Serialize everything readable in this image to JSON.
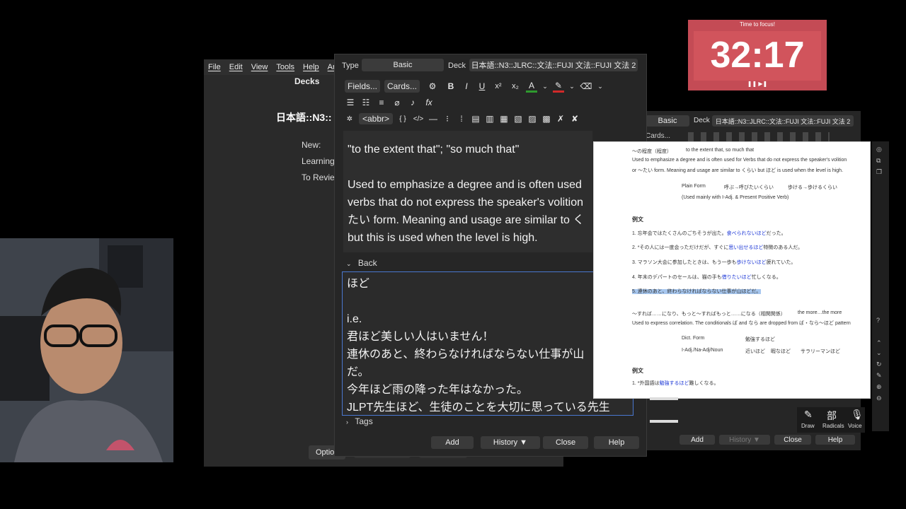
{
  "main_window": {
    "menu": [
      "File",
      "Edit",
      "View",
      "Tools",
      "Help",
      "Anki"
    ],
    "title": "Decks",
    "deck_name": "日本語::N3::",
    "stats": [
      "New:",
      "Learning",
      "To Revie"
    ],
    "options_label": "Option"
  },
  "add_window": {
    "type_label": "Type",
    "type_value": "Basic",
    "deck_label": "Deck",
    "deck_value": "日本語::N3::JLRC::文法::FUJI 文法::FUJI 文法 2",
    "fields_btn": "Fields...",
    "cards_btn": "Cards...",
    "format": {
      "bold": "B",
      "italic": "I",
      "underline": "U",
      "superscript": "x²",
      "subscript": "x₂",
      "font_color": "A",
      "abbr": "<abbr>",
      "braces": "{ }",
      "code": "</>",
      "math": "fx"
    },
    "front_lines": [
      "\"to the extent that\"; \"so much that\"",
      "",
      "Used to emphasize a degree and is often used",
      "verbs that do not express the speaker's volition",
      "たい form. Meaning and usage are similar to く",
      "but this is used when the level is high."
    ],
    "back_label": "Back",
    "back_lines": [
      "ほど",
      "",
      "i.e.",
      "君ほど美しい人はいません！",
      "連休のあと、終わらなければならない仕事が山",
      "だ。",
      "今年ほど雨の降った年はなかった。",
      "JLPT先生ほど、生徒のことを大切に思っている先生"
    ],
    "tags_label": "Tags",
    "buttons": {
      "add": "Add",
      "history": "History ▼",
      "close": "Close",
      "help": "Help"
    }
  },
  "add_window_2": {
    "type_value": "Basic",
    "deck_label": "Deck",
    "deck_value": "日本語::N3::JLRC::文法::FUJI 文法::FUJI 文法 2",
    "cards_btn": "Cards...",
    "buttons": {
      "add": "Add",
      "history": "History ▼",
      "close": "Close",
      "help": "Help"
    }
  },
  "preview": {
    "heading1": "〜の程度（程度）",
    "heading1_en": "to the extent that, so much that",
    "desc1": "Used to emphasize a degree and is often used for Verbs that do not express the speaker's volition",
    "desc2": "or 〜たい form. Meaning and usage are similar to くらい but ほど is used when the level is high.",
    "plain_form": "Plain Form",
    "pf1": "呼ぶ→呼びたいくらい",
    "pf2": "歩ける→歩けるくらい",
    "used_mainly": "(Used mainly with I-Adj. & Present Positive Verb)",
    "examples_title": "例文",
    "ex1": "1. 忘年会ではたくさんのごちそうが出た。",
    "ex1b": "食べられないほど",
    "ex1c": "だった。",
    "ex2": "2. *その人には一度会っただけだが、すぐに",
    "ex2b": "思い出せるほど",
    "ex2c": "特徴のある人だ。",
    "ex3": "3. マラソン大会に参加したときは、もう一歩も",
    "ex3b": "歩けないほど",
    "ex3c": "疲れていた。",
    "ex4": "4. 年末のデパートのセールは、猫の手も",
    "ex4b": "借りたいほど",
    "ex4c": "忙しくなる。",
    "ex5": "5. 連休のあと、終わらなければならない仕事が山ほどだ。",
    "heading2": "〜すれば……になり、もっと〜すればもっと……になる（相関関係）",
    "heading2_en": "the more…the more",
    "desc3": "Used to express correlation. The conditionals ば and なら are dropped from ば・なら〜ほど pattern",
    "dict_form": "Dict. Form",
    "df1": "勉強するほど",
    "adj_noun": "I-Adj./Na-Adj/Noun",
    "an1": "近いほど",
    "an2": "暇なほど",
    "an3": "サラリーマンほど",
    "examples_title2": "例文",
    "ex6": "1. *外国語は",
    "ex6b": "勉強するほど",
    "ex6c": "難しくなる。"
  },
  "timer": {
    "label": "Time to focus!",
    "time": "32:17",
    "controls": "❚❚ ▶❚"
  },
  "kanji_tool": {
    "draw": "Draw",
    "radicals": "Radicals",
    "voice": "Voice",
    "radicals_glyph": "部"
  },
  "colors": {
    "timer_bg": "#c44b55",
    "focus_border": "#4a78d0",
    "link_blue": "#1a35d6"
  }
}
